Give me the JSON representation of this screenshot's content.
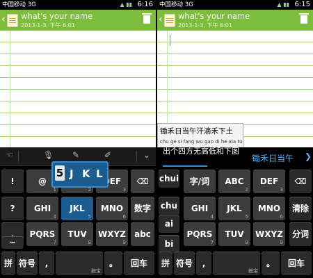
{
  "left": {
    "status": {
      "carrier": "中国移动 3G",
      "time": "6:16"
    },
    "note": {
      "title": "what's your name",
      "subtitle": "2013-1-3, 下午 6:01"
    },
    "popup": {
      "chars": [
        "5",
        "J",
        "K",
        "L"
      ]
    },
    "keys": {
      "r1": [
        {
          "l": "!"
        },
        {
          "l": "@",
          "s": "1"
        },
        {
          "l": "ABC",
          "s": "2"
        },
        {
          "l": "DEF",
          "s": "3"
        },
        {
          "l": "⌫"
        }
      ],
      "r2": [
        {
          "l": "?"
        },
        {
          "l": "GHI",
          "s": "4"
        },
        {
          "l": "JKL",
          "s": "5"
        },
        {
          "l": "MNO",
          "s": "6"
        },
        {
          "l": "数字"
        }
      ],
      "r3": [
        {
          "l": "."
        },
        {
          "l": "PQRS",
          "s": "7"
        },
        {
          "l": "TUV",
          "s": "8"
        },
        {
          "l": "WXYZ",
          "s": "9"
        },
        {
          "l": "abc"
        }
      ],
      "r3b": [
        {
          "l": "~"
        }
      ],
      "r4": [
        {
          "l": "拼"
        },
        {
          "l": "符号"
        },
        {
          "l": ","
        },
        {
          "l": "",
          "s": "触宝"
        },
        {
          "l": "。"
        },
        {
          "l": "回车"
        }
      ]
    }
  },
  "right": {
    "status": {
      "carrier": "中国移动 3G",
      "time": "6:15"
    },
    "note": {
      "title": "what's your name",
      "subtitle": "2013-1-3, 下午 6:01"
    },
    "tip": {
      "line1": "锄禾日当午汗滴禾下土",
      "line2": "chu ge si fang wu gao di he xia tu"
    },
    "candidates": {
      "first": "出个四方无高低和下图",
      "second": "锄禾日当午"
    },
    "keys": {
      "side": [
        {
          "l": "chui"
        },
        {
          "l": "chu"
        },
        {
          "l": "ai"
        },
        {
          "l": "bi"
        }
      ],
      "r1": [
        {
          "l": "字/词"
        },
        {
          "l": "ABC",
          "s": "2"
        },
        {
          "l": "DEF",
          "s": "3"
        },
        {
          "l": "⌫"
        }
      ],
      "r2": [
        {
          "l": "GHI",
          "s": "4"
        },
        {
          "l": "JKL",
          "s": "5"
        },
        {
          "l": "MNO",
          "s": "6"
        },
        {
          "l": "清除"
        }
      ],
      "r3": [
        {
          "l": "PQRS",
          "s": "7"
        },
        {
          "l": "TUV",
          "s": "8"
        },
        {
          "l": "WXYZ",
          "s": "9"
        },
        {
          "l": "分词"
        }
      ],
      "r4": [
        {
          "l": "拼"
        },
        {
          "l": "符号"
        },
        {
          "l": ","
        },
        {
          "l": "",
          "s": "触宝"
        },
        {
          "l": "。"
        },
        {
          "l": "回车"
        }
      ]
    }
  }
}
